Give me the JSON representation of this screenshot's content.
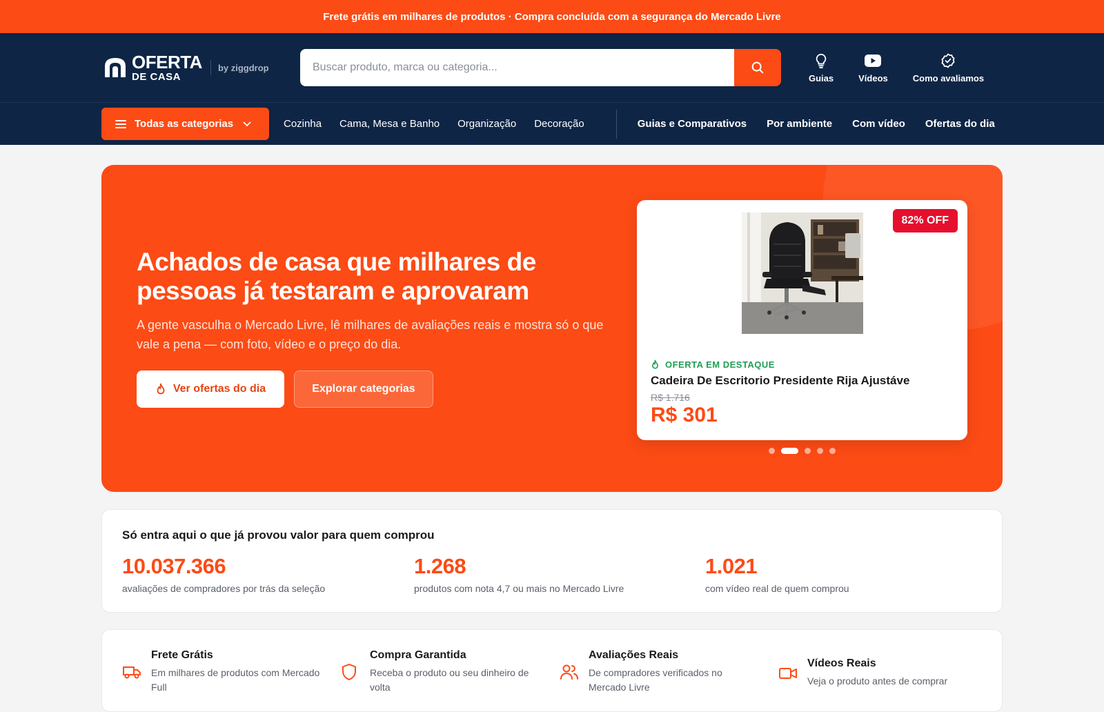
{
  "topbar": {
    "text": "Frete grátis em milhares de produtos · Compra concluída com a segurança do Mercado Livre"
  },
  "header": {
    "logo_line1": "OFERTA",
    "logo_line2": "DE CASA",
    "logo_by": "by ziggdrop",
    "search_placeholder": "Buscar produto, marca ou categoria...",
    "links": [
      {
        "label": "Guias",
        "icon": "lightbulb-icon"
      },
      {
        "label": "Vídeos",
        "icon": "video-play-icon"
      },
      {
        "label": "Como avaliamos",
        "icon": "verified-badge-icon"
      }
    ]
  },
  "nav": {
    "all_categories": "Todas as categorias",
    "categories": [
      "Cozinha",
      "Cama, Mesa e Banho",
      "Organização",
      "Decoração"
    ],
    "sections": [
      "Guias e Comparativos",
      "Por ambiente",
      "Com vídeo",
      "Ofertas do dia"
    ]
  },
  "hero": {
    "title": "Achados de casa que milhares de pessoas já testaram e aprovaram",
    "subtitle": "A gente vasculha o Mercado Livre, lê milhares de avaliações reais e mostra só o que vale a pena — com foto, vídeo e o preço do dia.",
    "primary_button": "Ver ofertas do dia",
    "secondary_button": "Explorar categorias",
    "carousel": {
      "slides": 5,
      "active_index": 1
    },
    "offer": {
      "badge": "82% OFF",
      "tag": "OFERTA EM DESTAQUE",
      "title": "Cadeira De Escritorio Presidente Rija Ajustáve",
      "old_price": "R$ 1.716",
      "new_price": "R$ 301"
    }
  },
  "stats": {
    "title": "Só entra aqui o que já provou valor para quem comprou",
    "items": [
      {
        "value": "10.037.366",
        "label": "avaliações de compradores por trás da seleção"
      },
      {
        "value": "1.268",
        "label": "produtos com nota 4,7 ou mais no Mercado Livre"
      },
      {
        "value": "1.021",
        "label": "com vídeo real de quem comprou"
      }
    ]
  },
  "features": [
    {
      "title": "Frete Grátis",
      "desc": "Em milhares de produtos com Mercado Full",
      "icon": "truck-icon"
    },
    {
      "title": "Compra Garantida",
      "desc": "Receba o produto ou seu dinheiro de volta",
      "icon": "shield-icon"
    },
    {
      "title": "Avaliações Reais",
      "desc": "De compradores verificados no Mercado Livre",
      "icon": "users-icon"
    },
    {
      "title": "Vídeos Reais",
      "desc": "Veja o produto antes de comprar",
      "icon": "video-camera-icon"
    }
  ],
  "colors": {
    "brand_orange": "#fc4b15",
    "navy": "#0e2545",
    "success_green": "#1f9d55",
    "badge_red": "#e5102d"
  }
}
